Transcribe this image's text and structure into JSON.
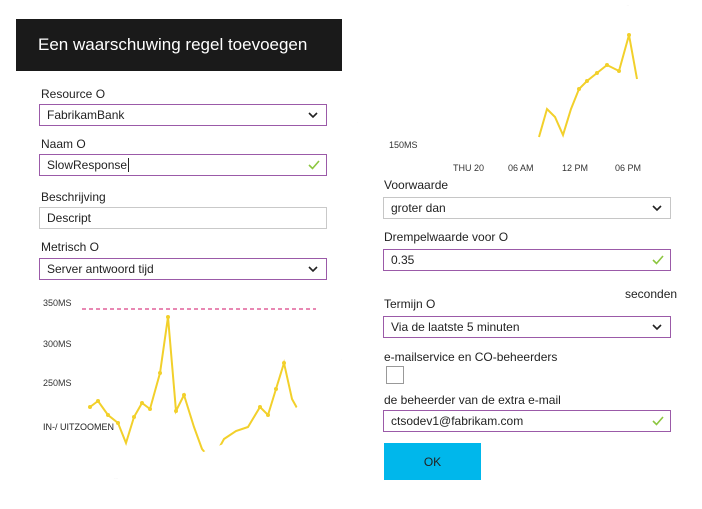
{
  "left": {
    "title": "Een waarschuwing regel toevoegen",
    "resource_label": "Resource O",
    "resource_value": "FabrikamBank",
    "name_label": "Naam O",
    "name_value": "SlowResponse",
    "description_label": "Beschrijving",
    "description_value": "Descript",
    "metric_label": "Metrisch O",
    "metric_value": "Server antwoord tijd",
    "chart_labels": [
      "350MS",
      "300MS",
      "250MS"
    ],
    "zoom_label": "IN-/ UITZOOMEN"
  },
  "right": {
    "chart_y_label": "150MS",
    "chart_x_labels": [
      "THU 20",
      "06 AM",
      "12 PM",
      "06 PM"
    ],
    "condition_label": "Voorwaarde",
    "condition_value": "groter dan",
    "threshold_label": "Drempelwaarde voor O",
    "threshold_value": "0.35",
    "seconds_label": "seconden",
    "period_label": "Termijn O",
    "period_value": "Via de laatste 5 minuten",
    "email_owners_label": "e-mailservice en CO-beheerders",
    "email_owners_checked": false,
    "extra_email_label": "de beheerder van de extra e-mail",
    "extra_email_value": "ctsodev1@fabrikam.com",
    "ok_label": "OK"
  },
  "colors": {
    "accent_border": "#9b5aa8",
    "chart_line": "#f2d02b",
    "threshold_line": "#e0609a",
    "ok_button": "#00b7eb",
    "valid_check": "#8cc63f",
    "titlebar": "#1a1a1a"
  },
  "icons": {
    "dropdown": "chevron-down-icon",
    "valid": "checkmark-icon"
  }
}
